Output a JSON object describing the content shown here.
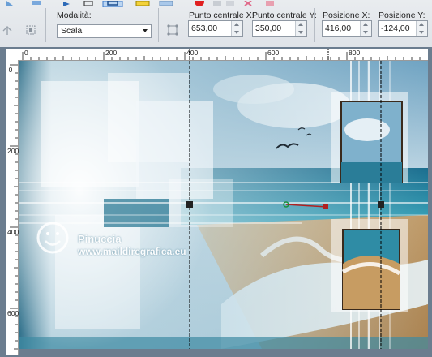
{
  "toolbar": {
    "mode_label": "Modalità:",
    "mode_value": "Scala",
    "center_x_label": "Punto centrale X:",
    "center_x_value": "653,00",
    "center_y_label": "Punto centrale Y:",
    "center_y_value": "350,00",
    "pos_x_label": "Posizione X:",
    "pos_x_value": "416,00",
    "pos_y_label": "Posizione Y:",
    "pos_y_value": "-124,00"
  },
  "ruler": {
    "h_labels": [
      "0",
      "200",
      "400",
      "600",
      "800"
    ],
    "v_labels": [
      "0",
      "200",
      "400",
      "600"
    ]
  },
  "watermark": {
    "name": "Pinuccia",
    "site": "www.maildiregrafica.eu"
  },
  "colors": {
    "accent_selected": "#3a78c9",
    "canvas_sky": "#8fb8cf",
    "sea": "#1f7f9a",
    "sand": "#c9a470"
  }
}
